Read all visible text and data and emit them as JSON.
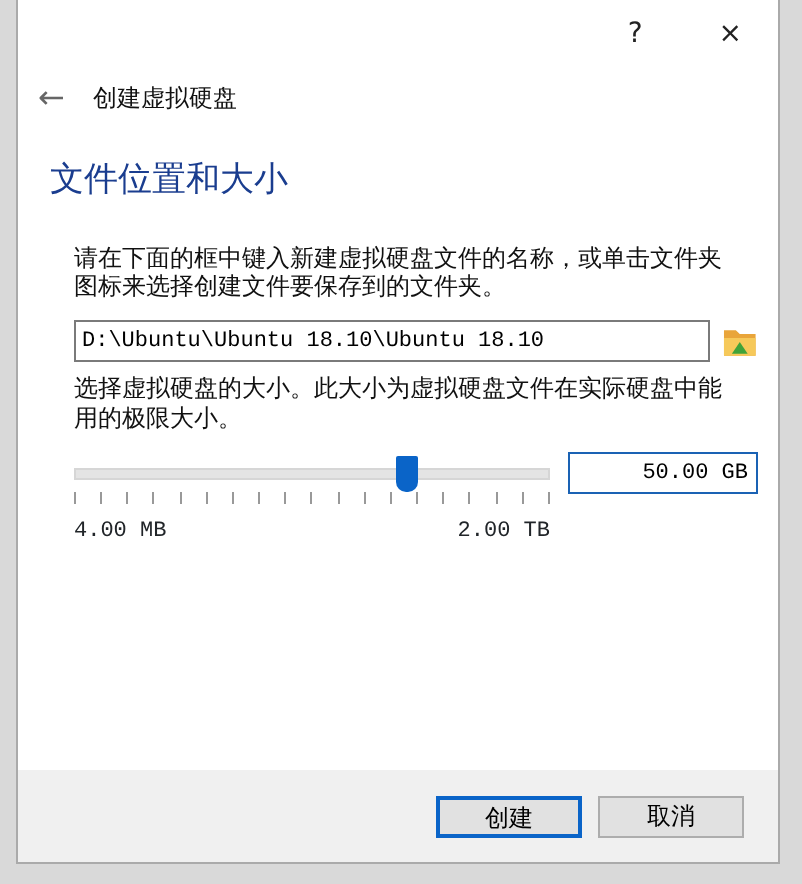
{
  "window": {
    "help": "?",
    "close": "×"
  },
  "header": {
    "back": "←",
    "title": "创建虚拟硬盘"
  },
  "heading": "文件位置和大小",
  "intro": "请在下面的框中键入新建虚拟硬盘文件的名称，或单击文件夹图标来选择创建文件要保存到的文件夹。",
  "file_path": {
    "value": "D:\\Ubuntu\\Ubuntu 18.10\\Ubuntu 18.10"
  },
  "size_text": "选择虚拟硬盘的大小。此大小为虚拟硬盘文件在实际硬盘中能用的极限大小。",
  "size_slider": {
    "level": 0.7,
    "min_label": "4.00 MB",
    "max_label": "2.00 TB"
  },
  "size_field": {
    "value": "50.00 GB"
  },
  "buttons": [
    {
      "label": "创建",
      "default": true
    },
    {
      "label": "取消",
      "default": false
    }
  ]
}
